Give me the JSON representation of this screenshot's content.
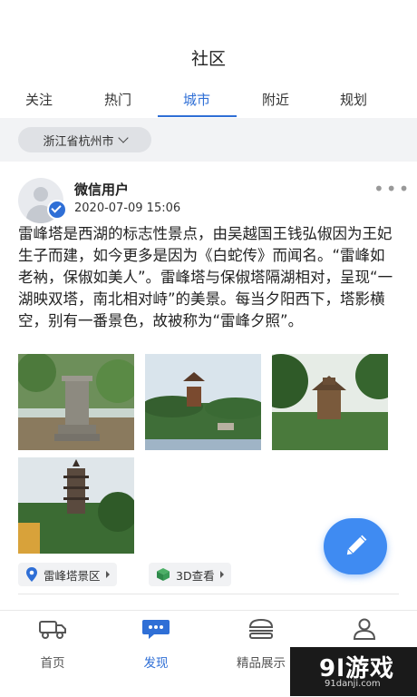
{
  "header": {
    "title": "社区"
  },
  "tabs": [
    {
      "label": "关注"
    },
    {
      "label": "热门"
    },
    {
      "label": "城市"
    },
    {
      "label": "附近"
    },
    {
      "label": "规划"
    }
  ],
  "filter": {
    "city": "浙江省杭州市"
  },
  "post": {
    "username": "微信用户",
    "timestamp": "2020-07-09 15:06",
    "text": "雷峰塔是西湖的标志性景点，由吴越国王钱弘俶因为王妃生子而建，如今更多是因为《白蛇传》而闻名。“雷峰如老衲，保俶如美人”。雷峰塔与保俶塔隔湖相对，呈现“一湖映双塔，南北相对峙”的美景。每当夕阳西下，塔影横空，别有一番景色，故被称为“雷峰夕照”。",
    "tags": [
      {
        "label": "雷峰塔景区",
        "icon": "location-pin-icon"
      },
      {
        "label": "3D查看",
        "icon": "cube-icon"
      }
    ]
  },
  "bottom_nav": [
    {
      "label": "首页",
      "icon": "truck-icon"
    },
    {
      "label": "发现",
      "icon": "chat-dots-icon"
    },
    {
      "label": "精品展示",
      "icon": "burger-icon"
    },
    {
      "label": "",
      "icon": "person-icon"
    }
  ],
  "watermark": {
    "logo": "9l游戏",
    "url": "91danji.com"
  },
  "colors": {
    "accent": "#2f6fd6",
    "fab": "#3f8bf2",
    "filter_bg": "#f2f3f5"
  }
}
